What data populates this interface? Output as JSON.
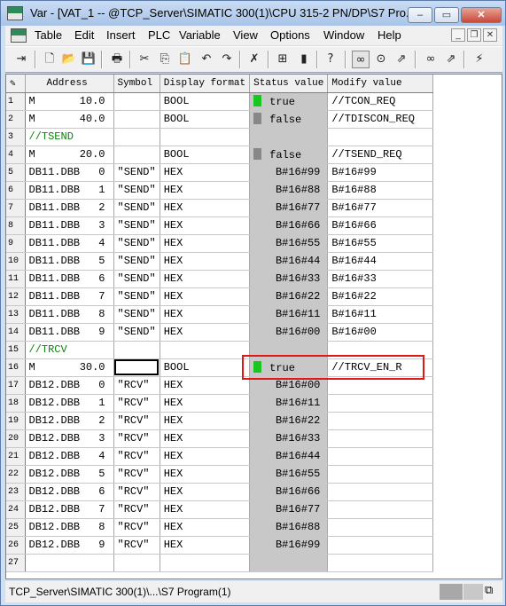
{
  "window": {
    "title": "Var - [VAT_1 -- @TCP_Server\\SIMATIC 300(1)\\CPU 315-2 PN/DP\\S7 Pro...",
    "minimize": "–",
    "maximize": "▭",
    "close": "✕"
  },
  "menu": {
    "items": [
      "Table",
      "Edit",
      "Insert",
      "PLC",
      "Variable",
      "View",
      "Options",
      "Window",
      "Help"
    ],
    "mdi_minimize": "_",
    "mdi_restore": "❐",
    "mdi_close": "✕"
  },
  "toolbar": {
    "icons": [
      "insert-arrow-icon",
      "new-icon",
      "open-icon",
      "save-icon",
      "print-icon",
      "cut-icon",
      "copy-icon",
      "paste-icon",
      "undo-icon",
      "redo-icon",
      "delete-icon",
      "network-icon",
      "plc-icon",
      "help-pointer-icon",
      "monitor-glasses-icon",
      "monitor-continuous-icon",
      "modify-variable-icon",
      "monitor-once-icon",
      "modify-once-icon",
      "force-icon"
    ]
  },
  "table": {
    "headers": [
      "Address",
      "Symbol",
      "Display format",
      "Status value",
      "Modify value"
    ],
    "rows": [
      {
        "n": "1",
        "addr": "M",
        "off": "10.0",
        "sym": "",
        "fmt": "BOOL",
        "status": "true",
        "led": "on",
        "modify": "//TCON_REQ"
      },
      {
        "n": "2",
        "addr": "M",
        "off": "40.0",
        "sym": "",
        "fmt": "BOOL",
        "status": "false",
        "led": "off",
        "modify": "//TDISCON_REQ"
      },
      {
        "n": "3",
        "comment": "//TSEND"
      },
      {
        "n": "4",
        "addr": "M",
        "off": "20.0",
        "sym": "",
        "fmt": "BOOL",
        "status": "false",
        "led": "off",
        "modify": "//TSEND_REQ"
      },
      {
        "n": "5",
        "addr": "DB11.DBB",
        "off": "0",
        "sym": "\"SEND\"",
        "fmt": "HEX",
        "status": "B#16#99",
        "modify": "B#16#99"
      },
      {
        "n": "6",
        "addr": "DB11.DBB",
        "off": "1",
        "sym": "\"SEND\"",
        "fmt": "HEX",
        "status": "B#16#88",
        "modify": "B#16#88"
      },
      {
        "n": "7",
        "addr": "DB11.DBB",
        "off": "2",
        "sym": "\"SEND\"",
        "fmt": "HEX",
        "status": "B#16#77",
        "modify": "B#16#77"
      },
      {
        "n": "8",
        "addr": "DB11.DBB",
        "off": "3",
        "sym": "\"SEND\"",
        "fmt": "HEX",
        "status": "B#16#66",
        "modify": "B#16#66"
      },
      {
        "n": "9",
        "addr": "DB11.DBB",
        "off": "4",
        "sym": "\"SEND\"",
        "fmt": "HEX",
        "status": "B#16#55",
        "modify": "B#16#55"
      },
      {
        "n": "10",
        "addr": "DB11.DBB",
        "off": "5",
        "sym": "\"SEND\"",
        "fmt": "HEX",
        "status": "B#16#44",
        "modify": "B#16#44"
      },
      {
        "n": "11",
        "addr": "DB11.DBB",
        "off": "6",
        "sym": "\"SEND\"",
        "fmt": "HEX",
        "status": "B#16#33",
        "modify": "B#16#33"
      },
      {
        "n": "12",
        "addr": "DB11.DBB",
        "off": "7",
        "sym": "\"SEND\"",
        "fmt": "HEX",
        "status": "B#16#22",
        "modify": "B#16#22"
      },
      {
        "n": "13",
        "addr": "DB11.DBB",
        "off": "8",
        "sym": "\"SEND\"",
        "fmt": "HEX",
        "status": "B#16#11",
        "modify": "B#16#11"
      },
      {
        "n": "14",
        "addr": "DB11.DBB",
        "off": "9",
        "sym": "\"SEND\"",
        "fmt": "HEX",
        "status": "B#16#00",
        "modify": "B#16#00"
      },
      {
        "n": "15",
        "comment": "//TRCV"
      },
      {
        "n": "16",
        "addr": "M",
        "off": "30.0",
        "sym": "",
        "fmt": "BOOL",
        "status": "true",
        "led": "on",
        "modify": "//TRCV_EN_R",
        "selected": true
      },
      {
        "n": "17",
        "addr": "DB12.DBB",
        "off": "0",
        "sym": "\"RCV\"",
        "fmt": "HEX",
        "status": "B#16#00",
        "modify": ""
      },
      {
        "n": "18",
        "addr": "DB12.DBB",
        "off": "1",
        "sym": "\"RCV\"",
        "fmt": "HEX",
        "status": "B#16#11",
        "modify": ""
      },
      {
        "n": "19",
        "addr": "DB12.DBB",
        "off": "2",
        "sym": "\"RCV\"",
        "fmt": "HEX",
        "status": "B#16#22",
        "modify": ""
      },
      {
        "n": "20",
        "addr": "DB12.DBB",
        "off": "3",
        "sym": "\"RCV\"",
        "fmt": "HEX",
        "status": "B#16#33",
        "modify": ""
      },
      {
        "n": "21",
        "addr": "DB12.DBB",
        "off": "4",
        "sym": "\"RCV\"",
        "fmt": "HEX",
        "status": "B#16#44",
        "modify": ""
      },
      {
        "n": "22",
        "addr": "DB12.DBB",
        "off": "5",
        "sym": "\"RCV\"",
        "fmt": "HEX",
        "status": "B#16#55",
        "modify": ""
      },
      {
        "n": "23",
        "addr": "DB12.DBB",
        "off": "6",
        "sym": "\"RCV\"",
        "fmt": "HEX",
        "status": "B#16#66",
        "modify": ""
      },
      {
        "n": "24",
        "addr": "DB12.DBB",
        "off": "7",
        "sym": "\"RCV\"",
        "fmt": "HEX",
        "status": "B#16#77",
        "modify": ""
      },
      {
        "n": "25",
        "addr": "DB12.DBB",
        "off": "8",
        "sym": "\"RCV\"",
        "fmt": "HEX",
        "status": "B#16#88",
        "modify": ""
      },
      {
        "n": "26",
        "addr": "DB12.DBB",
        "off": "9",
        "sym": "\"RCV\"",
        "fmt": "HEX",
        "status": "B#16#99",
        "modify": ""
      },
      {
        "n": "27"
      }
    ]
  },
  "statusbar": {
    "path": "TCP_Server\\SIMATIC 300(1)\\...\\S7 Program(1)"
  },
  "colors": {
    "led_on": "#18c820",
    "led_off": "#888888",
    "comment": "#108010",
    "highlight": "#e01818"
  }
}
